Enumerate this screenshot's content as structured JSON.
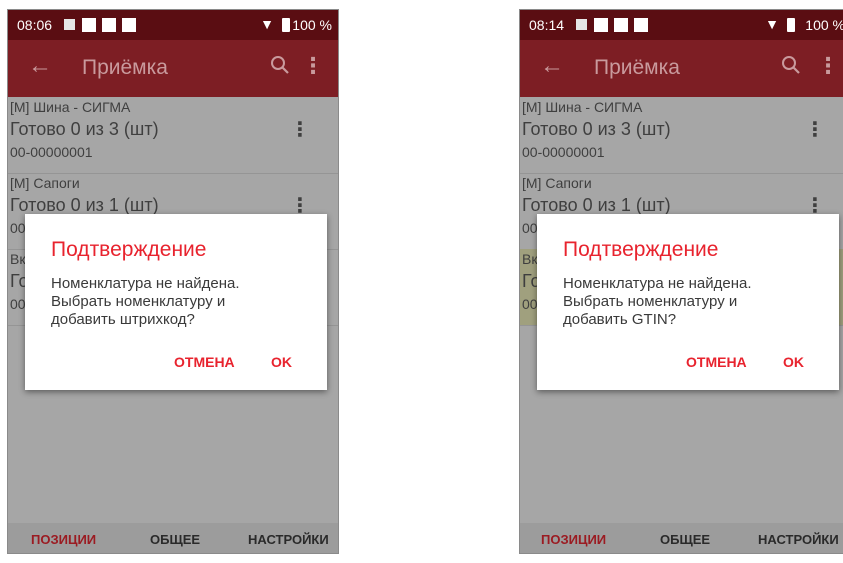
{
  "screens": [
    {
      "status": {
        "time": "08:06",
        "battery": "100 %"
      },
      "appbar": {
        "title": "Приёмка",
        "back_icon": "arrow-left-icon",
        "search_icon": "search-icon",
        "menu_icon": "more-vert-icon"
      },
      "items": [
        {
          "name": "[М] Шина - СИГМА",
          "status": "Готово 0 из 3 (шт)",
          "code": "00-00000001"
        },
        {
          "name": "[М] Сапоги",
          "status": "Готово 0 из 1 (шт)",
          "code": "00"
        },
        {
          "name": "Вк",
          "status": "Го",
          "code": "00"
        }
      ],
      "dialog": {
        "title": "Подтверждение",
        "message": "Номенклатура не найдена.\nВыбрать номенклатуру и\nдобавить штрихкод?",
        "cancel": "ОТМЕНА",
        "ok": "OK"
      },
      "tabs": [
        "ПОЗИЦИИ",
        "ОБЩЕЕ",
        "НАСТРОЙКИ"
      ],
      "active_tab": "ПОЗИЦИИ"
    },
    {
      "status": {
        "time": "08:14",
        "battery": "100 %"
      },
      "appbar": {
        "title": "Приёмка",
        "back_icon": "arrow-left-icon",
        "search_icon": "search-icon",
        "menu_icon": "more-vert-icon"
      },
      "items": [
        {
          "name": "[М] Шина - СИГМА",
          "status": "Готово 0 из 3 (шт)",
          "code": "00-00000001"
        },
        {
          "name": "[М] Сапоги",
          "status": "Готово 0 из 1 (шт)",
          "code": "00"
        },
        {
          "name": "Вк",
          "status": "Го",
          "code": "00"
        }
      ],
      "dialog": {
        "title": "Подтверждение",
        "message": "Номенклатура не найдена.\nВыбрать номенклатуру и\nдобавить GTIN?",
        "cancel": "ОТМЕНА",
        "ok": "OK"
      },
      "tabs": [
        "ПОЗИЦИИ",
        "ОБЩЕЕ",
        "НАСТРОЙКИ"
      ],
      "active_tab": "ПОЗИЦИИ"
    }
  ],
  "colors": {
    "appbar": "#7d1e24",
    "statusbar": "#5a0d12",
    "accent": "#e8232e",
    "highlight_row": "#a0a07e"
  }
}
